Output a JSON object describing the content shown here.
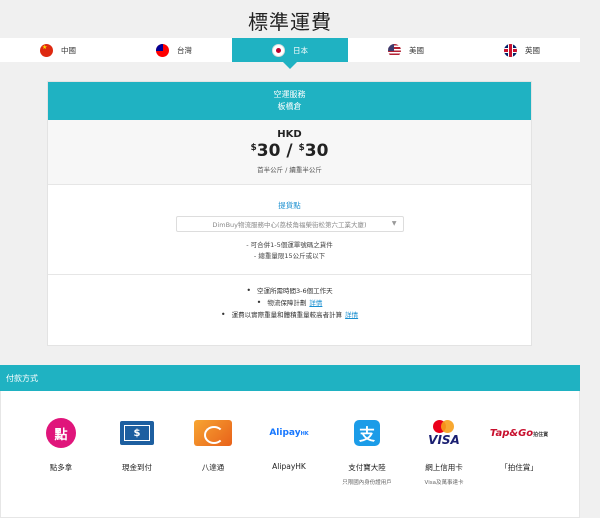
{
  "page_title": "標準運費",
  "tabs": [
    {
      "label": "中國",
      "flag": "cn"
    },
    {
      "label": "台灣",
      "flag": "tw"
    },
    {
      "label": "日本",
      "flag": "jp",
      "active": true
    },
    {
      "label": "美國",
      "flag": "us"
    },
    {
      "label": "英國",
      "flag": "uk"
    }
  ],
  "shipping": {
    "service_line1": "空運服務",
    "service_line2": "板橋倉",
    "currency": "HKD",
    "price_symbol_1": "$",
    "price_value_1": "30",
    "price_separator": " / ",
    "price_symbol_2": "$",
    "price_value_2": "30",
    "unit_text": "首半公斤 / 續重半公斤",
    "pickup_label": "提貨點",
    "pickup_selected": "DimBuy物流服務中心(荔枝角福榮街松第六工業大廈)",
    "pickup_note_1": "- 可合併1-5個運單號碼之貨件",
    "pickup_note_2": "- 總重量限15公斤或以下",
    "service_notes": [
      {
        "text": "空運所需時間3-6個工作天",
        "link": ""
      },
      {
        "text": "物流保障計劃",
        "link": "詳情"
      },
      {
        "text": "運費以實際重量和體積重量較高者計算",
        "link": "詳情"
      }
    ]
  },
  "payment": {
    "heading": "付款方式",
    "methods": [
      {
        "name": "點多拿",
        "sub": "",
        "icon": "dimpoint-icon",
        "glyph": "點"
      },
      {
        "name": "現金到付",
        "sub": "",
        "icon": "cash-icon",
        "glyph": "$"
      },
      {
        "name": "八達通",
        "sub": "",
        "icon": "octopus-icon",
        "glyph": ""
      },
      {
        "name": "AlipayHK",
        "sub": "",
        "icon": "alipayhk-icon",
        "glyph": "Alipay",
        "glyph_sub": "HK"
      },
      {
        "name": "支付寶大陸",
        "sub": "只限國內身份證用戶",
        "icon": "alipay-icon",
        "glyph": "支"
      },
      {
        "name": "網上信用卡",
        "sub": "Visa及萬事達卡",
        "icon": "visa-mastercard-icon",
        "glyph": "VISA"
      },
      {
        "name": "「拍住賞」",
        "sub": "",
        "icon": "tapngo-icon",
        "glyph": "Tap&Go",
        "glyph_sub": "拍住賞"
      }
    ]
  },
  "colors": {
    "accent": "#1fb2c2",
    "link": "#1a8fd0"
  }
}
